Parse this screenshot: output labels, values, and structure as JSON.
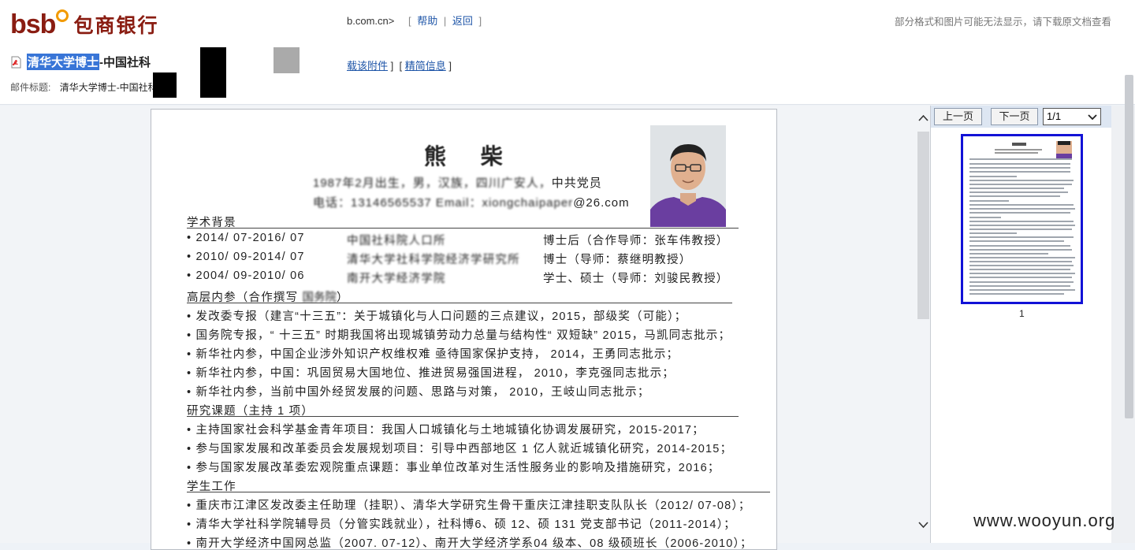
{
  "header": {
    "logo_latin": "bsb",
    "logo_chinese": "包商银行",
    "domain_fragment": "b.com.cn>",
    "nav": {
      "help": "帮助",
      "back": "返回"
    },
    "notice": "部分格式和图片可能无法显示，请下载原文档查看",
    "subject_highlight": "清华大学博士",
    "subject_rest": "-中国社科",
    "attachment_links": {
      "download": "载该附件",
      "compact": "精简信息"
    },
    "mail_title_label": "邮件标题:",
    "mail_title_value": "清华大学博士-中国社科"
  },
  "document": {
    "name": "熊 柴",
    "info_line1_blurred": "1987年2月出生，男，汉族，四川广安人，",
    "info_line1_clear": "中共党员",
    "info_line2_blurred": "电话：13146565537 Email：xiongchaipaper",
    "info_line2_clear": "@26.com",
    "sections": {
      "academic": "学术背景",
      "internal_ref": "高层内参（合作撰写 ",
      "internal_ref_tail": "）",
      "research": "研究课题（主持 1 项）",
      "student_work": "学生工作"
    },
    "academic_rows": [
      {
        "period": "• 2014/ 07-2016/ 07",
        "org": "中国社科院人口所",
        "role": "博士后（合作导师：张车伟教授）"
      },
      {
        "period": "• 2010/ 09-2014/ 07",
        "org": "清华大学社科学院经济学研究所",
        "role": "博士（导师：蔡继明教授）"
      },
      {
        "period": "• 2004/ 09-2010/ 06",
        "org": "南开大学经济学院",
        "role": "学士、硕士（导师：刘骏民教授）"
      }
    ],
    "internal_items": [
      "• 发改委专报（建言“十三五”：关于城镇化与人口问题的三点建议，2015，部级奖（可能）；",
      "• 国务院专报，“ 十三五” 时期我国将出现城镇劳动力总量与结构性“ 双短缺” 2015，马凯同志批示；",
      "• 新华社内参，中国企业涉外知识产权维权难 亟待国家保护支持， 2014，王勇同志批示；",
      "• 新华社内参，中国：巩固贸易大国地位、推进贸易强国进程， 2010，李克强同志批示；",
      "• 新华社内参，当前中国外经贸发展的问题、思路与对策， 2010，王岐山同志批示；"
    ],
    "research_items": [
      "• 主持国家社会科学基金青年项目：我国人口城镇化与土地城镇化协调发展研究，2015-2017；",
      "• 参与国家发展和改革委员会发展规划项目：引导中西部地区 1 亿人就近城镇化研究，2014-2015；",
      "• 参与国家发展改革委宏观院重点课题：事业单位改革对生活性服务业的影响及措施研究，2016；"
    ],
    "student_items": [
      "• 重庆市江津区发改委主任助理（挂职）、清华大学研究生骨干重庆江津挂职支队队长（2012/ 07-08）；",
      "• 清华大学社科学院辅导员（分管实践就业），社科博6、硕 12、硕 131 党支部书记（2011-2014）；",
      "• 南开大学经济中国网总监（2007. 07-12）、南开大学经济学系04 级本、08 级硕班长（2006-2010）；"
    ]
  },
  "thumbnails": {
    "prev": "上一页",
    "next": "下一页",
    "page_select": "1/1",
    "page_number": "1"
  },
  "watermark": "www.wooyun.org",
  "colors": {
    "brand": "#8a1d12",
    "logo_accent": "#f29a00",
    "link": "#1f56a8",
    "highlight": "#3875d7",
    "thumb_border": "#1212d6"
  }
}
